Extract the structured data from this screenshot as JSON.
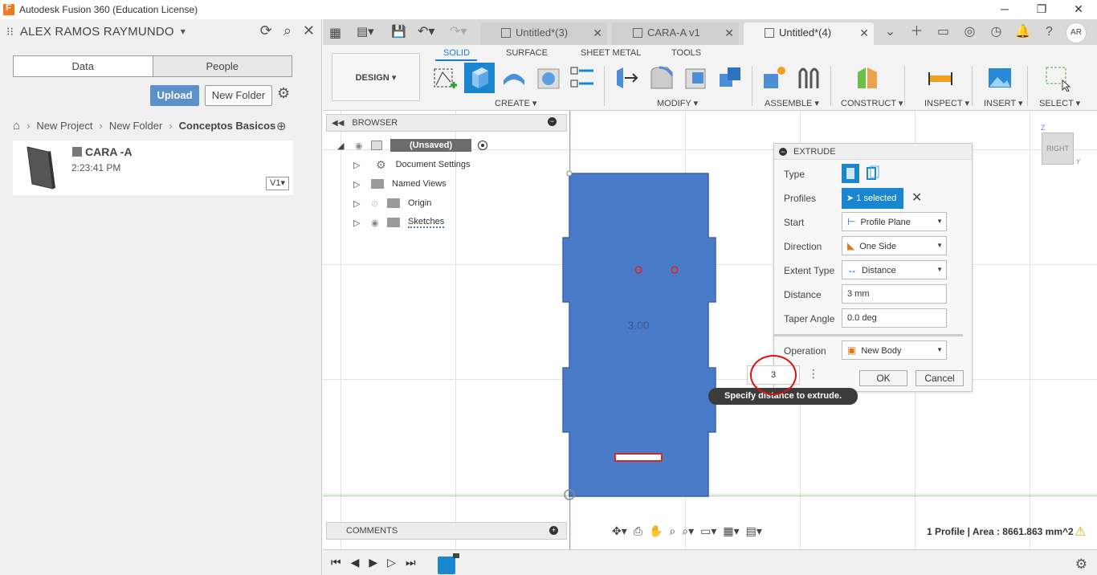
{
  "window": {
    "title": "Autodesk Fusion 360 (Education License)"
  },
  "data_panel": {
    "user": "ALEX RAMOS RAYMUNDO",
    "tabs": [
      "Data",
      "People"
    ],
    "upload_label": "Upload",
    "new_folder_label": "New Folder",
    "breadcrumb": [
      "New Project",
      "New Folder",
      "Conceptos Basicos"
    ],
    "file": {
      "name": "CARA -A",
      "time": "2:23:41 PM",
      "version": "V1"
    }
  },
  "doc_tabs": [
    {
      "label": "Untitled*(3)"
    },
    {
      "label": "CARA-A v1"
    },
    {
      "label": "Untitled*(4)"
    }
  ],
  "avatar": "AR",
  "toolbar": {
    "workspace": "DESIGN",
    "tabs": [
      "SOLID",
      "SURFACE",
      "SHEET METAL",
      "TOOLS"
    ],
    "groups": [
      "CREATE",
      "MODIFY",
      "ASSEMBLE",
      "CONSTRUCT",
      "INSPECT",
      "INSERT",
      "SELECT"
    ]
  },
  "browser": {
    "title": "BROWSER",
    "root": "(Unsaved)",
    "items": [
      "Document Settings",
      "Named Views",
      "Origin",
      "Sketches"
    ]
  },
  "canvas": {
    "dimension_label": "3.00"
  },
  "extrude": {
    "title": "EXTRUDE",
    "labels": {
      "type": "Type",
      "profiles": "Profiles",
      "start": "Start",
      "direction": "Direction",
      "extent_type": "Extent Type",
      "distance": "Distance",
      "taper_angle": "Taper Angle",
      "operation": "Operation"
    },
    "values": {
      "profiles": "1 selected",
      "start": "Profile Plane",
      "direction": "One Side",
      "extent_type": "Distance",
      "distance": "3 mm",
      "taper_angle": "0.0 deg",
      "operation": "New Body"
    },
    "ok_label": "OK",
    "cancel_label": "Cancel",
    "heads_up_value": "3",
    "tooltip": "Specify distance to extrude."
  },
  "viewcube": {
    "face": "RIGHT",
    "z": "Z",
    "y": "Y"
  },
  "comments": {
    "title": "COMMENTS"
  },
  "status": {
    "text": "1 Profile | Area : 8661.863 mm^2"
  }
}
